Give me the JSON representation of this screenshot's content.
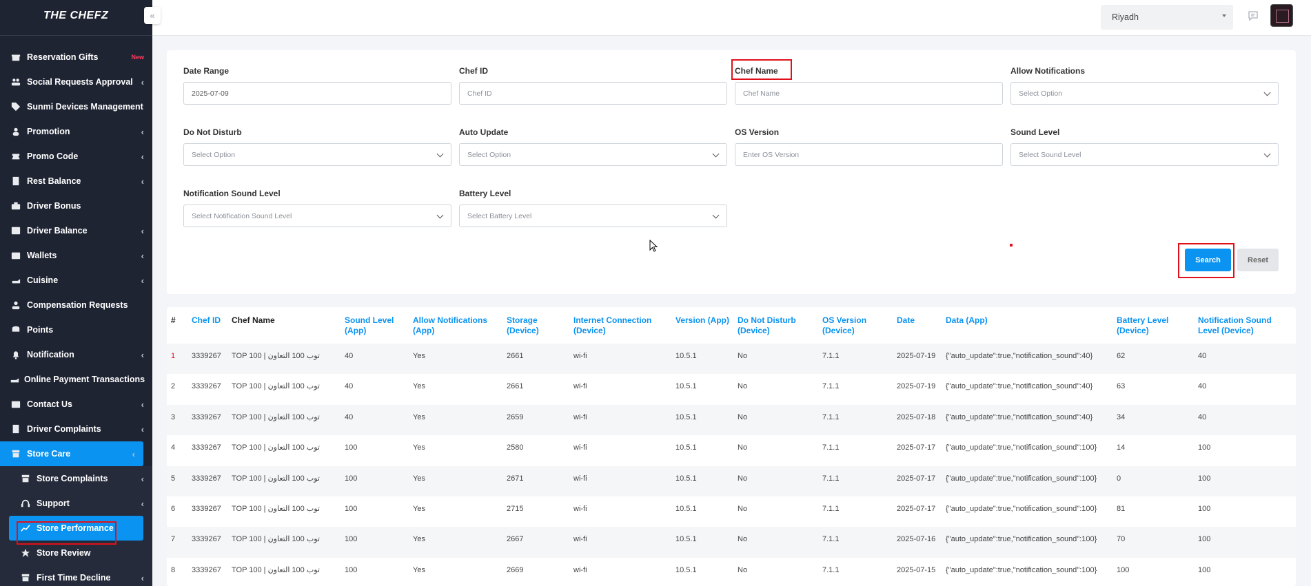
{
  "brand": "THE CHEFZ",
  "topbar": {
    "city": "Riyadh"
  },
  "sidebar": {
    "items": [
      {
        "label": "Reservation Gifts",
        "badge": "New",
        "chevron": false,
        "icon": "gift-icon"
      },
      {
        "label": "Social Requests Approval",
        "chevron": true,
        "icon": "users-icon"
      },
      {
        "label": "Sunmi Devices Management",
        "chevron": false,
        "icon": "tag-icon"
      },
      {
        "label": "Promotion",
        "chevron": true,
        "icon": "user-icon"
      },
      {
        "label": "Promo Code",
        "chevron": true,
        "icon": "ticket-icon"
      },
      {
        "label": "Rest Balance",
        "chevron": true,
        "icon": "receipt-icon"
      },
      {
        "label": "Driver Bonus",
        "chevron": false,
        "icon": "briefcase-icon"
      },
      {
        "label": "Driver Balance",
        "chevron": true,
        "icon": "image-icon"
      },
      {
        "label": "Wallets",
        "chevron": true,
        "icon": "wallet-icon"
      },
      {
        "label": "Cuisine",
        "chevron": true,
        "icon": "hand-icon"
      },
      {
        "label": "Compensation Requests",
        "chevron": false,
        "icon": "people-icon"
      },
      {
        "label": "Points",
        "chevron": false,
        "icon": "coins-icon"
      },
      {
        "label": "Notification",
        "chevron": true,
        "icon": "bell-icon"
      },
      {
        "label": "Online Payment Transactions",
        "chevron": false,
        "icon": "hand-icon"
      },
      {
        "label": "Contact Us",
        "chevron": true,
        "icon": "inbox-icon"
      },
      {
        "label": "Driver Complaints",
        "chevron": true,
        "icon": "receipt-icon"
      },
      {
        "label": "Store Care",
        "chevron": true,
        "icon": "store-icon",
        "active": true
      }
    ],
    "sub_items": [
      {
        "label": "Store Complaints",
        "chevron": true,
        "icon": "store-icon"
      },
      {
        "label": "Support",
        "chevron": true,
        "icon": "headset-icon"
      },
      {
        "label": "Store Performance",
        "chevron": false,
        "icon": "chart-icon",
        "active": true
      },
      {
        "label": "Store Review",
        "chevron": false,
        "icon": "star-icon"
      },
      {
        "label": "First Time Decline",
        "chevron": true,
        "icon": "store-icon"
      }
    ]
  },
  "filters": {
    "date_range": {
      "label": "Date Range",
      "value": "2025-07-09"
    },
    "chef_id": {
      "label": "Chef ID",
      "placeholder": "Chef ID"
    },
    "chef_name": {
      "label": "Chef Name",
      "placeholder": "Chef Name"
    },
    "allow_notifications": {
      "label": "Allow Notifications",
      "value": "Select Option"
    },
    "do_not_disturb": {
      "label": "Do Not Disturb",
      "value": "Select Option"
    },
    "auto_update": {
      "label": "Auto Update",
      "value": "Select Option"
    },
    "os_version": {
      "label": "OS Version",
      "placeholder": "Enter OS Version"
    },
    "sound_level": {
      "label": "Sound Level",
      "value": "Select Sound Level"
    },
    "notification_sound_level": {
      "label": "Notification Sound Level",
      "value": "Select Notification Sound Level"
    },
    "battery_level": {
      "label": "Battery Level",
      "value": "Select Battery Level"
    },
    "search_label": "Search",
    "reset_label": "Reset"
  },
  "table": {
    "headers": [
      "#",
      "Chef ID",
      "Chef Name",
      "Sound Level (App)",
      "Allow Notifications (App)",
      "Storage (Device)",
      "Internet Connection (Device)",
      "Version (App)",
      "Do Not Disturb (Device)",
      "OS Version (Device)",
      "Date",
      "Data (App)",
      "Battery Level (Device)",
      "Notification Sound Level (Device)"
    ],
    "rows": [
      [
        "1",
        "3339267",
        "TOP 100 | توب 100 التعاون",
        "40",
        "Yes",
        "2661",
        "wi-fi",
        "10.5.1",
        "No",
        "7.1.1",
        "2025-07-19",
        "{\"auto_update\":true,\"notification_sound\":40}",
        "62",
        "40"
      ],
      [
        "2",
        "3339267",
        "TOP 100 | توب 100 التعاون",
        "40",
        "Yes",
        "2661",
        "wi-fi",
        "10.5.1",
        "No",
        "7.1.1",
        "2025-07-19",
        "{\"auto_update\":true,\"notification_sound\":40}",
        "63",
        "40"
      ],
      [
        "3",
        "3339267",
        "TOP 100 | توب 100 التعاون",
        "40",
        "Yes",
        "2659",
        "wi-fi",
        "10.5.1",
        "No",
        "7.1.1",
        "2025-07-18",
        "{\"auto_update\":true,\"notification_sound\":40}",
        "34",
        "40"
      ],
      [
        "4",
        "3339267",
        "TOP 100 | توب 100 التعاون",
        "100",
        "Yes",
        "2580",
        "wi-fi",
        "10.5.1",
        "No",
        "7.1.1",
        "2025-07-17",
        "{\"auto_update\":true,\"notification_sound\":100}",
        "14",
        "100"
      ],
      [
        "5",
        "3339267",
        "TOP 100 | توب 100 التعاون",
        "100",
        "Yes",
        "2671",
        "wi-fi",
        "10.5.1",
        "No",
        "7.1.1",
        "2025-07-17",
        "{\"auto_update\":true,\"notification_sound\":100}",
        "0",
        "100"
      ],
      [
        "6",
        "3339267",
        "TOP 100 | توب 100 التعاون",
        "100",
        "Yes",
        "2715",
        "wi-fi",
        "10.5.1",
        "No",
        "7.1.1",
        "2025-07-17",
        "{\"auto_update\":true,\"notification_sound\":100}",
        "81",
        "100"
      ],
      [
        "7",
        "3339267",
        "TOP 100 | توب 100 التعاون",
        "100",
        "Yes",
        "2667",
        "wi-fi",
        "10.5.1",
        "No",
        "7.1.1",
        "2025-07-16",
        "{\"auto_update\":true,\"notification_sound\":100}",
        "70",
        "100"
      ],
      [
        "8",
        "3339267",
        "TOP 100 | توب 100 التعاون",
        "100",
        "Yes",
        "2669",
        "wi-fi",
        "10.5.1",
        "No",
        "7.1.1",
        "2025-07-15",
        "{\"auto_update\":true,\"notification_sound\":100}",
        "100",
        "100"
      ]
    ]
  }
}
